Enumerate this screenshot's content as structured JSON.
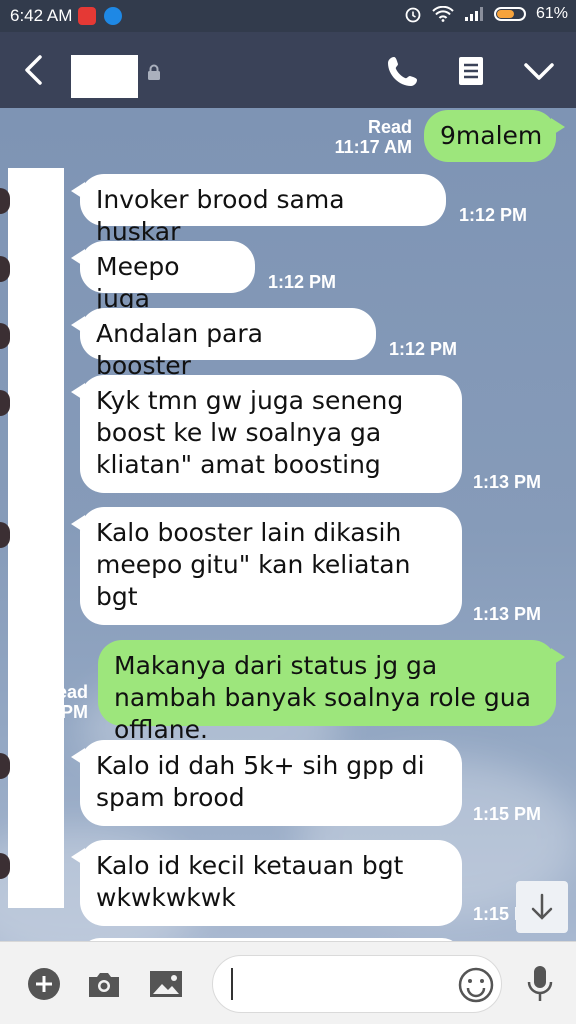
{
  "status_bar": {
    "time": "6:42 AM",
    "battery": "61%"
  },
  "header": {
    "contact_name": ""
  },
  "messages": [
    {
      "side": "out",
      "text": "9malem",
      "status": "Read",
      "time": "11:17 AM"
    },
    {
      "side": "in",
      "text": "Invoker brood sama huskar",
      "time": "1:12 PM"
    },
    {
      "side": "in",
      "text": "Meepo juga",
      "time": "1:12 PM"
    },
    {
      "side": "in",
      "text": "Andalan para booster",
      "time": "1:12 PM"
    },
    {
      "side": "in",
      "text": "Kyk tmn gw juga seneng boost ke lw soalnya ga kliatan\" amat boosting",
      "time": "1:13 PM"
    },
    {
      "side": "in",
      "text": "Kalo booster lain dikasih meepo gitu\" kan keliatan bgt",
      "time": "1:13 PM"
    },
    {
      "side": "out",
      "text": "Makanya dari status jg ga nambah banyak soalnya role gua offlane.",
      "status_partial": "ead",
      "time_partial": "PM"
    },
    {
      "side": "in",
      "text": "Kalo id dah 5k+ sih gpp di spam brood",
      "time": "1:15 PM"
    },
    {
      "side": "in",
      "text": "Kalo id kecil ketauan bgt wkwkwkwk",
      "time_partial": "1:15 P"
    }
  ],
  "input_bar": {
    "placeholder": ""
  },
  "colors": {
    "header_bg": "#3a4258",
    "status_bg": "#323b4c",
    "outgoing_bubble": "#9de67c",
    "incoming_bubble": "#ffffff"
  }
}
